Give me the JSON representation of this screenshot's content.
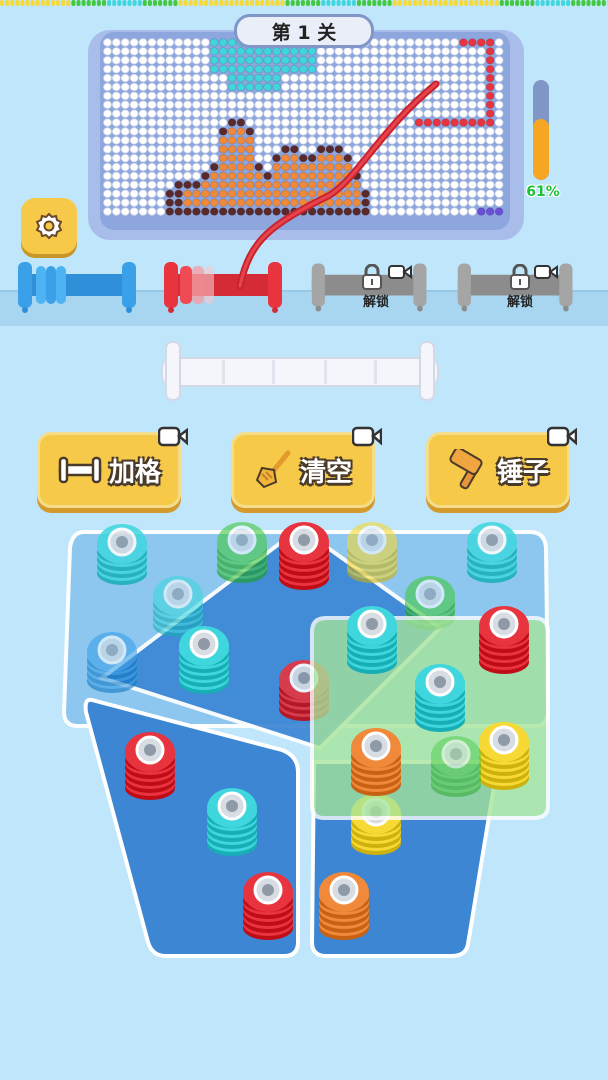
{
  "level": {
    "title": "第 1 关"
  },
  "progress": {
    "value": 0.61,
    "label": "61%"
  },
  "spools": [
    {
      "color": "#3aa0e8",
      "state": "active"
    },
    {
      "color": "#e8343f",
      "state": "active"
    },
    {
      "color": "#9b9b9b",
      "state": "locked",
      "label": "解锁"
    },
    {
      "color": "#9b9b9b",
      "state": "locked",
      "label": "解锁"
    }
  ],
  "powerups": [
    {
      "label": "加格",
      "icon": "rod-icon"
    },
    {
      "label": "清空",
      "icon": "broom-icon"
    },
    {
      "label": "锤子",
      "icon": "hammer-icon"
    }
  ],
  "colors": {
    "background": "#bfe6fb",
    "button": "#f7c948",
    "red": "#e8343f",
    "cyan": "#3fd6de",
    "green": "#42c93f",
    "yellow": "#f6d935",
    "blue": "#3aa0e8",
    "orange": "#f0893a",
    "brown": "#5a2a2a",
    "panel_blue": "#3c86d4",
    "panel_green": "#a6e59a"
  }
}
